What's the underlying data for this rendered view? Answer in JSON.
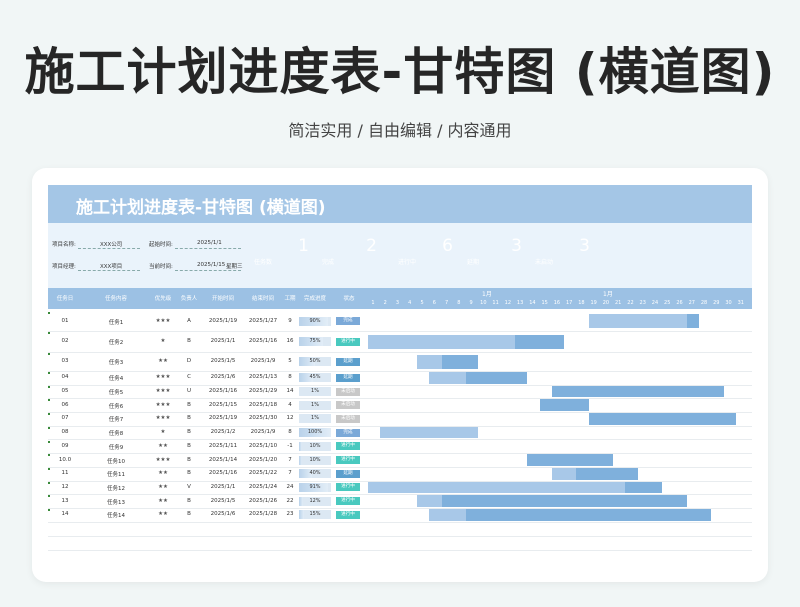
{
  "hero": {
    "title": "施工计划进度表-甘特图 (横道图)",
    "subtitle": "简洁实用 / 自由编辑 / 内容通用"
  },
  "sheet": {
    "title": "施工计划进度表-甘特图 (横道图)",
    "meta": {
      "project_name_label": "项目名称:",
      "project_name_value": "XXX公司",
      "start_label": "起始时间:",
      "start_value": "2025/1/1",
      "manager_label": "项目经理:",
      "manager_value": "XXX项目",
      "current_label": "当前时间:",
      "current_value": "2025/1/15",
      "current_weekday": "星期三"
    },
    "kpis": [
      {
        "value": "1",
        "label": "任务数",
        "color": "#7ba9d8"
      },
      {
        "value": "2",
        "label": "完成",
        "color": "#9fc2e4"
      },
      {
        "value": "6",
        "label": "进行中",
        "color": "#5ccfc6"
      },
      {
        "value": "3",
        "label": "延期",
        "color": "#6aaad3"
      },
      {
        "value": "3",
        "label": "未启动",
        "color": "#c9c9c9"
      }
    ],
    "headers": [
      "任务日",
      "任务内容",
      "优先级",
      "负责人",
      "开始时间",
      "结束时间",
      "工期",
      "完成进度",
      "状态"
    ],
    "months": [
      "1月",
      "1月"
    ],
    "days": [
      "1",
      "2",
      "3",
      "4",
      "5",
      "6",
      "7",
      "8",
      "9",
      "10",
      "11",
      "12",
      "13",
      "14",
      "15",
      "16",
      "17",
      "18",
      "19",
      "20",
      "21",
      "22",
      "23",
      "24",
      "25",
      "26",
      "27",
      "28",
      "29",
      "30",
      "31"
    ],
    "status_colors": {
      "完成": "#7ba9d8",
      "进行中": "#49c9bf",
      "延期": "#5b9fcd",
      "未启动": "#c8c8c8"
    },
    "bar_colors": {
      "light": "#a8c8e8",
      "dark": "#7fb0dc"
    },
    "rows": [
      {
        "id": "01",
        "task": "任务1",
        "priority": "★★★",
        "owner": "A",
        "start": "2025/1/19",
        "end": "2025/1/27",
        "days": "9",
        "progress": "90%",
        "pct": 90,
        "status": "完成",
        "bar": [
          {
            "from": 19,
            "to": 27,
            "tone": "light"
          },
          {
            "from": 27,
            "to": 28,
            "tone": "dark"
          }
        ]
      },
      {
        "id": "02",
        "task": "任务2",
        "priority": "★",
        "owner": "B",
        "start": "2025/1/1",
        "end": "2025/1/16",
        "days": "16",
        "progress": "75%",
        "pct": 75,
        "status": "进行中",
        "bar": [
          {
            "from": 1,
            "to": 13,
            "tone": "light"
          },
          {
            "from": 13,
            "to": 17,
            "tone": "dark"
          }
        ]
      },
      {
        "id": "03",
        "task": "任务3",
        "priority": "★★",
        "owner": "D",
        "start": "2025/1/5",
        "end": "2025/1/9",
        "days": "5",
        "progress": "50%",
        "pct": 50,
        "status": "延期",
        "bar": [
          {
            "from": 5,
            "to": 7,
            "tone": "light"
          },
          {
            "from": 7,
            "to": 10,
            "tone": "dark"
          }
        ]
      },
      {
        "id": "04",
        "task": "任务4",
        "priority": "★★★",
        "owner": "C",
        "start": "2025/1/6",
        "end": "2025/1/13",
        "days": "8",
        "progress": "45%",
        "pct": 45,
        "status": "延期",
        "bar": [
          {
            "from": 6,
            "to": 9,
            "tone": "light"
          },
          {
            "from": 9,
            "to": 14,
            "tone": "dark"
          }
        ]
      },
      {
        "id": "05",
        "task": "任务5",
        "priority": "★★★",
        "owner": "U",
        "start": "2025/1/16",
        "end": "2025/1/29",
        "days": "14",
        "progress": "1%",
        "pct": 1,
        "status": "未启动",
        "bar": [
          {
            "from": 16,
            "to": 30,
            "tone": "dark"
          }
        ]
      },
      {
        "id": "06",
        "task": "任务6",
        "priority": "★★★",
        "owner": "B",
        "start": "2025/1/15",
        "end": "2025/1/18",
        "days": "4",
        "progress": "1%",
        "pct": 1,
        "status": "未启动",
        "bar": [
          {
            "from": 15,
            "to": 19,
            "tone": "dark"
          }
        ]
      },
      {
        "id": "07",
        "task": "任务7",
        "priority": "★★★",
        "owner": "B",
        "start": "2025/1/19",
        "end": "2025/1/30",
        "days": "12",
        "progress": "1%",
        "pct": 1,
        "status": "未启动",
        "bar": [
          {
            "from": 19,
            "to": 31,
            "tone": "dark"
          }
        ]
      },
      {
        "id": "08",
        "task": "任务8",
        "priority": "★",
        "owner": "B",
        "start": "2025/1/2",
        "end": "2025/1/9",
        "days": "8",
        "progress": "100%",
        "pct": 100,
        "status": "完成",
        "bar": [
          {
            "from": 2,
            "to": 10,
            "tone": "light"
          }
        ]
      },
      {
        "id": "09",
        "task": "任务9",
        "priority": "★★",
        "owner": "B",
        "start": "2025/1/11",
        "end": "2025/1/10",
        "days": "-1",
        "progress": "10%",
        "pct": 10,
        "status": "进行中",
        "bar": []
      },
      {
        "id": "10.0",
        "task": "任务10",
        "priority": "★★★",
        "owner": "B",
        "start": "2025/1/14",
        "end": "2025/1/20",
        "days": "7",
        "progress": "10%",
        "pct": 10,
        "status": "进行中",
        "bar": [
          {
            "from": 14,
            "to": 21,
            "tone": "dark"
          }
        ]
      },
      {
        "id": "11",
        "task": "任务11",
        "priority": "★★",
        "owner": "B",
        "start": "2025/1/16",
        "end": "2025/1/22",
        "days": "7",
        "progress": "40%",
        "pct": 40,
        "status": "延期",
        "bar": [
          {
            "from": 16,
            "to": 18,
            "tone": "light"
          },
          {
            "from": 18,
            "to": 23,
            "tone": "dark"
          }
        ]
      },
      {
        "id": "12",
        "task": "任务12",
        "priority": "★★",
        "owner": "V",
        "start": "2025/1/1",
        "end": "2025/1/24",
        "days": "24",
        "progress": "91%",
        "pct": 91,
        "status": "进行中",
        "bar": [
          {
            "from": 1,
            "to": 22,
            "tone": "light"
          },
          {
            "from": 22,
            "to": 25,
            "tone": "dark"
          }
        ]
      },
      {
        "id": "13",
        "task": "任务13",
        "priority": "★★",
        "owner": "B",
        "start": "2025/1/5",
        "end": "2025/1/26",
        "days": "22",
        "progress": "12%",
        "pct": 12,
        "status": "进行中",
        "bar": [
          {
            "from": 5,
            "to": 7,
            "tone": "light"
          },
          {
            "from": 7,
            "to": 27,
            "tone": "dark"
          }
        ]
      },
      {
        "id": "14",
        "task": "任务14",
        "priority": "★★",
        "owner": "B",
        "start": "2025/1/6",
        "end": "2025/1/28",
        "days": "23",
        "progress": "15%",
        "pct": 15,
        "status": "进行中",
        "bar": [
          {
            "from": 6,
            "to": 9,
            "tone": "light"
          },
          {
            "from": 9,
            "to": 29,
            "tone": "dark"
          }
        ]
      }
    ]
  }
}
